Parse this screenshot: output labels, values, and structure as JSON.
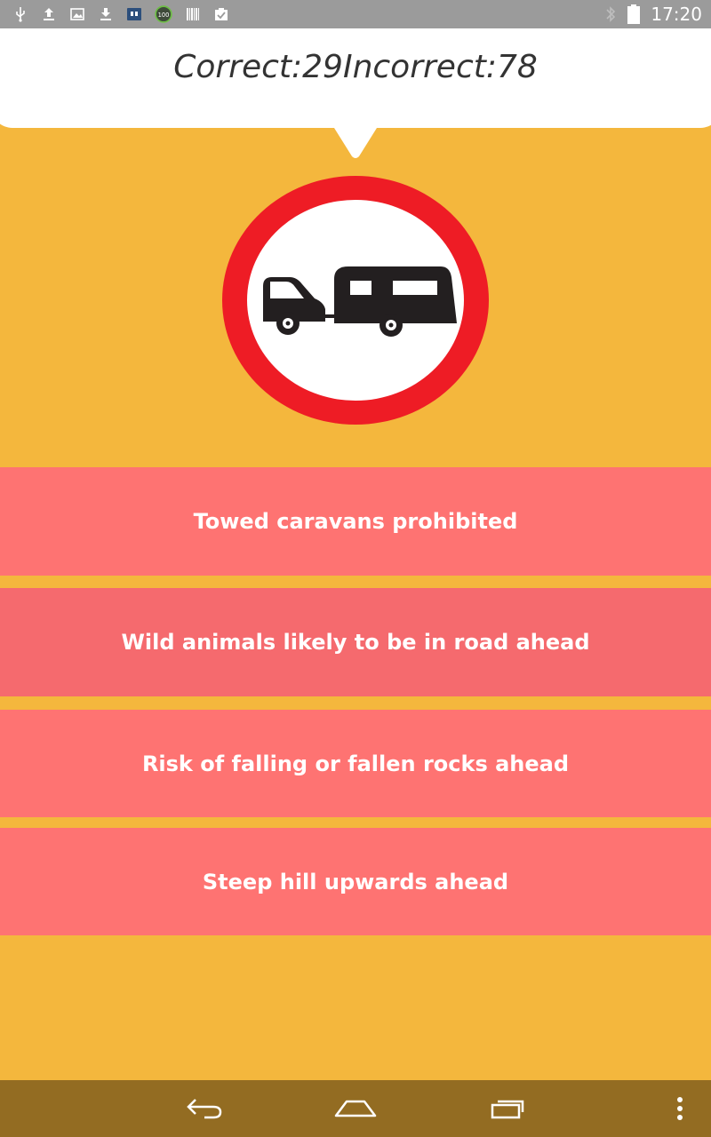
{
  "status_bar": {
    "time": "17:20",
    "battery_badge": "100",
    "left_icons": [
      "usb-icon",
      "upload-icon",
      "image-icon",
      "download-icon",
      "app-icon",
      "battery-100-icon",
      "barcode-icon",
      "clipboard-check-icon"
    ],
    "right_icons": [
      "bluetooth-icon",
      "battery-icon"
    ]
  },
  "score": {
    "correct_label": "Correct:",
    "correct_value": "29",
    "incorrect_label": "Incorrect:",
    "incorrect_value": "78"
  },
  "question": {
    "sign_icon": "towed-caravan-prohibited-sign",
    "colors": {
      "ring": "#EE1C25",
      "symbol": "#231F20",
      "face": "#FFFFFF"
    }
  },
  "answers": [
    {
      "label": "Towed caravans prohibited"
    },
    {
      "label": "Wild animals likely to be in road ahead"
    },
    {
      "label": "Risk of falling or fallen rocks ahead"
    },
    {
      "label": "Steep hill upwards ahead"
    }
  ],
  "nav_bar": {
    "icons": [
      "back-icon",
      "home-icon",
      "recent-apps-icon",
      "overflow-menu-icon"
    ]
  },
  "colors": {
    "background": "#F4B73D",
    "answer": "#FE7372",
    "answer_pressed": "#F56A6E",
    "status_bar": "#9B9B9B",
    "nav_bar": "#936C22"
  }
}
